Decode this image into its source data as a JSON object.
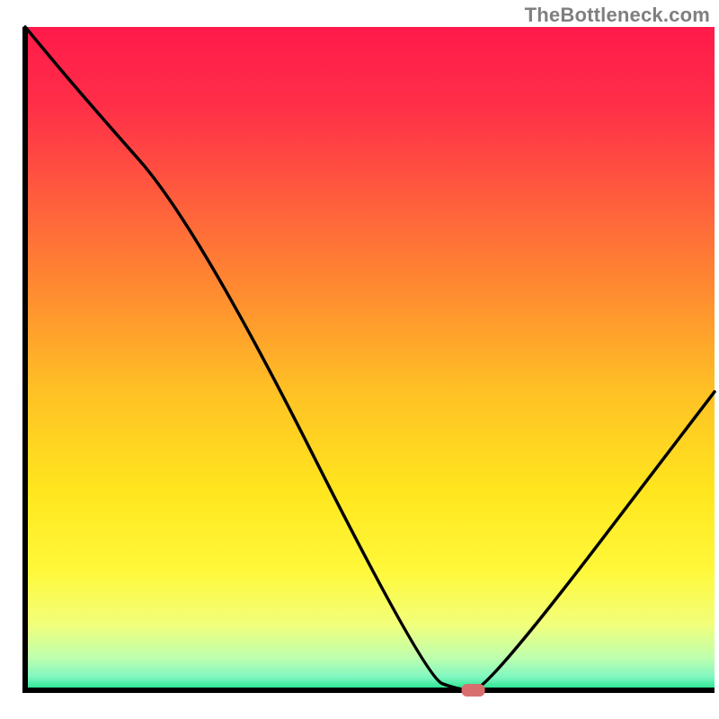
{
  "attribution": "TheBottleneck.com",
  "chart_data": {
    "type": "line",
    "title": "",
    "xlabel": "",
    "ylabel": "",
    "xlim": [
      0,
      100
    ],
    "ylim": [
      0,
      100
    ],
    "legend": false,
    "grid": false,
    "series": [
      {
        "name": "bottleneck-curve",
        "x": [
          0,
          8,
          25,
          58,
          63,
          67,
          100
        ],
        "y": [
          100,
          90,
          70,
          2,
          0,
          0,
          45
        ]
      }
    ],
    "marker": {
      "name": "optimal-point",
      "x": 65,
      "y": 0,
      "color": "#d96e6e"
    },
    "background_gradient": {
      "stops": [
        {
          "pos": 0.0,
          "color": "#ff1a4b"
        },
        {
          "pos": 0.12,
          "color": "#ff2f48"
        },
        {
          "pos": 0.25,
          "color": "#ff5a3e"
        },
        {
          "pos": 0.4,
          "color": "#ff8c30"
        },
        {
          "pos": 0.55,
          "color": "#ffc125"
        },
        {
          "pos": 0.7,
          "color": "#ffe61e"
        },
        {
          "pos": 0.82,
          "color": "#fff83a"
        },
        {
          "pos": 0.9,
          "color": "#f2ff7a"
        },
        {
          "pos": 0.95,
          "color": "#c0ffae"
        },
        {
          "pos": 0.98,
          "color": "#80f7c0"
        },
        {
          "pos": 1.0,
          "color": "#1be38b"
        }
      ]
    },
    "axes_color": "#000000"
  }
}
